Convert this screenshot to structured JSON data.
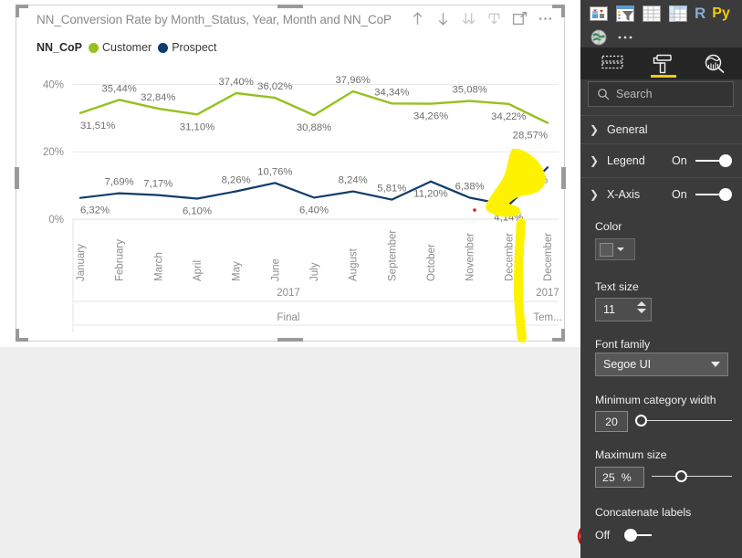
{
  "visual": {
    "title": "NN_Conversion Rate by Month_Status, Year, Month and NN_CoP",
    "toolbar": [
      {
        "name": "drill-up-icon",
        "label": "Drill up"
      },
      {
        "name": "drill-down-icon",
        "label": "Drill down"
      },
      {
        "name": "expand-all-down-icon",
        "label": "Expand all down one level"
      },
      {
        "name": "drill-mode-icon",
        "label": "Go to the next level in the hierarchy"
      },
      {
        "name": "focus-mode-icon",
        "label": "Focus mode"
      },
      {
        "name": "more-options-icon",
        "label": "More options"
      }
    ],
    "legend": {
      "title": "NN_CoP",
      "items": [
        {
          "label": "Customer",
          "color": "#95C11F"
        },
        {
          "label": "Prospect",
          "color": "#113C6B"
        }
      ]
    },
    "group_labels": [
      "2017",
      "2017"
    ],
    "hierarchy_labels": [
      "Final",
      "Tem..."
    ]
  },
  "chart_data": {
    "type": "line",
    "title": "NN_Conversion Rate by Month_Status, Year, Month and NN_CoP",
    "xlabel": "",
    "ylabel": "",
    "ylim": [
      0,
      45
    ],
    "yticks": [
      0,
      20,
      40
    ],
    "ytick_labels": [
      "0%",
      "20%",
      "40%"
    ],
    "grid": true,
    "legend_position": "top-left",
    "categories": [
      "January",
      "February",
      "March",
      "April",
      "May",
      "June",
      "July",
      "August",
      "September",
      "October",
      "November",
      "December",
      "December"
    ],
    "series": [
      {
        "name": "Customer",
        "color": "#95C11F",
        "values": [
          31.51,
          35.44,
          32.84,
          31.1,
          37.4,
          36.02,
          30.88,
          37.96,
          34.34,
          34.26,
          35.08,
          34.22,
          28.57
        ],
        "labels": [
          "31,51%",
          "35,44%",
          "32,84%",
          "31,10%",
          "37,40%",
          "36,02%",
          "30,88%",
          "37,96%",
          "34,34%",
          "34,26%",
          "35,08%",
          "34,22%",
          "28,57%"
        ]
      },
      {
        "name": "Prospect",
        "color": "#113C6B",
        "values": [
          6.32,
          7.69,
          7.17,
          6.1,
          8.26,
          10.76,
          6.4,
          8.24,
          5.81,
          11.2,
          6.38,
          4.14,
          15.38
        ],
        "labels": [
          "6,32%",
          "7,69%",
          "7,17%",
          "6,10%",
          "8,26%",
          "10,76%",
          "6,40%",
          "8,24%",
          "5,81%",
          "11,20%",
          "6,38%",
          "4,14%",
          "15,38%"
        ]
      }
    ]
  },
  "annotations": {
    "highlight_color": "#FFF200",
    "ellipse_color": "#E00000",
    "dot_color": "#D02020"
  },
  "right_pane": {
    "gallery_icons": [
      {
        "name": "stacked-bar-chart-icon"
      },
      {
        "name": "funnel-chart-icon"
      },
      {
        "name": "table-icon"
      },
      {
        "name": "matrix-icon"
      },
      {
        "name": "r-script-visual-icon",
        "label": "R"
      },
      {
        "name": "python-visual-icon",
        "label": "Py"
      },
      {
        "name": "globe-map-icon"
      },
      {
        "name": "more-visuals-icon"
      }
    ],
    "tabs": [
      {
        "name": "fields-tab",
        "active": false
      },
      {
        "name": "format-tab",
        "active": true
      },
      {
        "name": "analytics-tab",
        "active": false
      }
    ],
    "search": {
      "placeholder": "Search",
      "value": ""
    },
    "sections": [
      {
        "name": "general",
        "title": "General",
        "expanded": false,
        "toggle": null
      },
      {
        "name": "legend",
        "title": "Legend",
        "expanded": false,
        "toggle": "On"
      },
      {
        "name": "x-axis",
        "title": "X-Axis",
        "expanded": true,
        "toggle": "On"
      }
    ],
    "xaxis_settings": {
      "color_label": "Color",
      "text_size_label": "Text size",
      "text_size_value": "11",
      "font_family_label": "Font family",
      "font_family_value": "Segoe UI",
      "min_category_width_label": "Minimum category width",
      "min_category_width_value": "20",
      "maximum_size_label": "Maximum size",
      "maximum_size_value": "25",
      "maximum_size_unit": "%",
      "concatenate_labels_label": "Concatenate labels",
      "concatenate_labels_value": "Off"
    }
  }
}
